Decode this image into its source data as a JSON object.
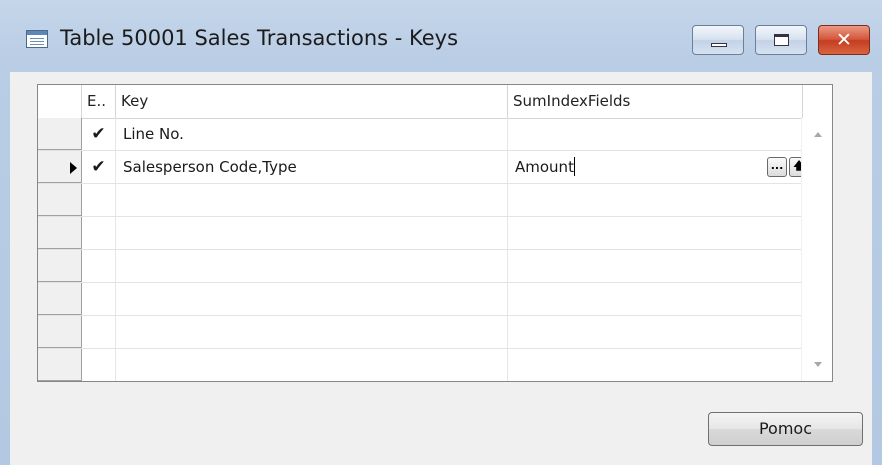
{
  "window": {
    "title": "Table 50001 Sales Transactions - Keys",
    "close_glyph": "✕"
  },
  "grid": {
    "columns": {
      "enabled": "E..",
      "key": "Key",
      "sum_index_fields": "SumIndexFields"
    },
    "rows": [
      {
        "enabled": "✔",
        "key": "Line No.",
        "sum_index_fields": ""
      },
      {
        "enabled": "✔",
        "key": "Salesperson Code,Type",
        "sum_index_fields": "Amount"
      }
    ],
    "active_row_buttons": {
      "lookup": "...",
      "sort": "🡅"
    }
  },
  "buttons": {
    "help": "Pomoc"
  },
  "icons": {
    "window_icon": "table-icon",
    "minimize": "minimize-icon",
    "maximize": "maximize-icon",
    "close": "close-icon",
    "row_pointer": "triangle-right-icon",
    "scroll_up": "chevron-up-icon",
    "scroll_down": "chevron-down-icon"
  }
}
